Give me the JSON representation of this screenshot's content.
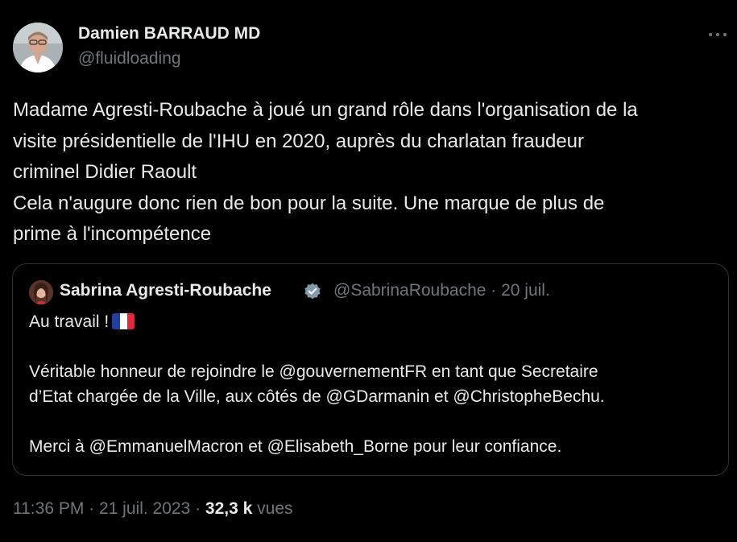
{
  "author": {
    "name": "Damien BARRAUD MD",
    "handle": "@fluidloading"
  },
  "more_icon": "more-horizontal-icon",
  "tweet": {
    "lines": [
      "Madame Agresti-Roubache à joué un grand rôle dans l'organisation de la",
      "visite présidentielle de l'IHU en 2020, auprès du charlatan fraudeur",
      "criminel Didier Raoult",
      "Cela n'augure donc rien de bon pour la suite. Une marque de plus de",
      "prime à l'incompétence"
    ]
  },
  "quoted": {
    "name": "Sabrina Agresti-Roubache",
    "verified_icon": "verified-badge-icon",
    "handle_date": "@SabrinaRoubache · 20 juil.",
    "line1": "Au travail !",
    "flag_icon": "france-flag-icon",
    "line2": "Véritable honneur de rejoindre le @gouvernementFR en tant que Secretaire",
    "line3": "d’Etat chargée de la Ville, aux côtés de @GDarmanin et @ChristopheBechu.",
    "line4": "Merci à @EmmanuelMacron et @Elisabeth_Borne pour leur confiance."
  },
  "meta": {
    "time_date": "11:36 PM · 21 juil. 2023 · ",
    "views_count": "32,3 k",
    "views_label": "vues"
  },
  "colors": {
    "background": "#000000",
    "text": "#e7e9ea",
    "secondary": "#71767b",
    "border": "#2f3336",
    "verified": "#829aab"
  }
}
